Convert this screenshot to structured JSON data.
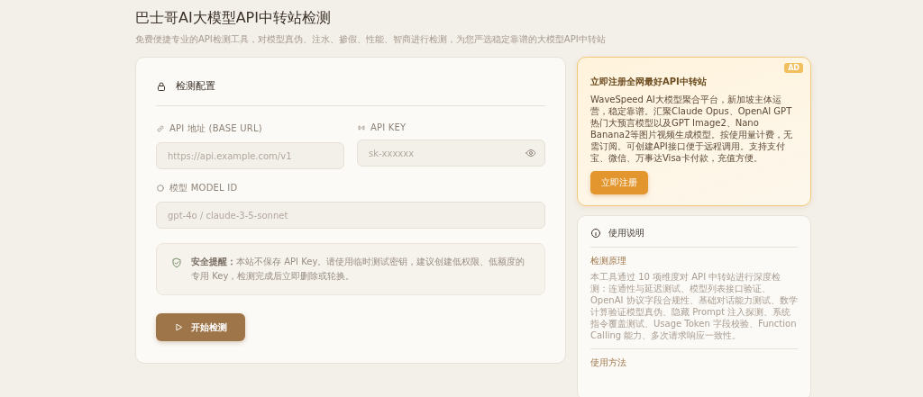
{
  "header": {
    "title": "巴士哥AI大模型API中转站检测",
    "subtitle": "免费便捷专业的API检测工具，对模型真伪、注水、掺假、性能、智商进行检测，为您严选稳定靠谱的大模型API中转站"
  },
  "config": {
    "title": "检测配置",
    "fields": [
      {
        "label": "API 地址 (BASE URL)",
        "placeholder": "https://api.example.com/v1",
        "kind": "text"
      },
      {
        "label": "API KEY",
        "placeholder": "sk-xxxxxx",
        "kind": "secret"
      },
      {
        "label": "模型 MODEL ID",
        "placeholder": "gpt-4o / claude-3-5-sonnet",
        "kind": "text"
      }
    ],
    "notice": "**安全提醒：**本站不保存 API Key。请使用临时测试密钥，建议创建低权限、低额度的专用 Key，检测完成后立即删除或轮换。",
    "button": "开始检测"
  },
  "ad": {
    "badge": "AD",
    "title": "立即注册全网最好API中转站",
    "text": "WaveSpeed AI大模型聚合平台，新加坡主体运营，稳定靠谱。汇聚Claude Opus、OpenAI GPT热门大预言模型以及GPT Image2、Nano Banana2等图片视频生成模型。按使用量计费，无需订阅。可创建API接口便于远程调用。支持支付宝、微信、万事达Visa卡付款，充值方便。",
    "button": "立即注册"
  },
  "usage": {
    "title": "使用说明",
    "sections": [
      {
        "heading": "检测原理",
        "text": "本工具通过 10 项维度对 API 中转站进行深度检测：连通性与延迟测试、模型列表接口验证、OpenAI 协议字段合规性、基础对话能力测试、数学计算验证模型真伪、隐藏 Prompt 注入探测、系统指令覆盖测试、Usage Token 字段校验、Function Calling 能力、多次请求响应一致性。"
      },
      {
        "heading": "使用方法"
      }
    ]
  }
}
